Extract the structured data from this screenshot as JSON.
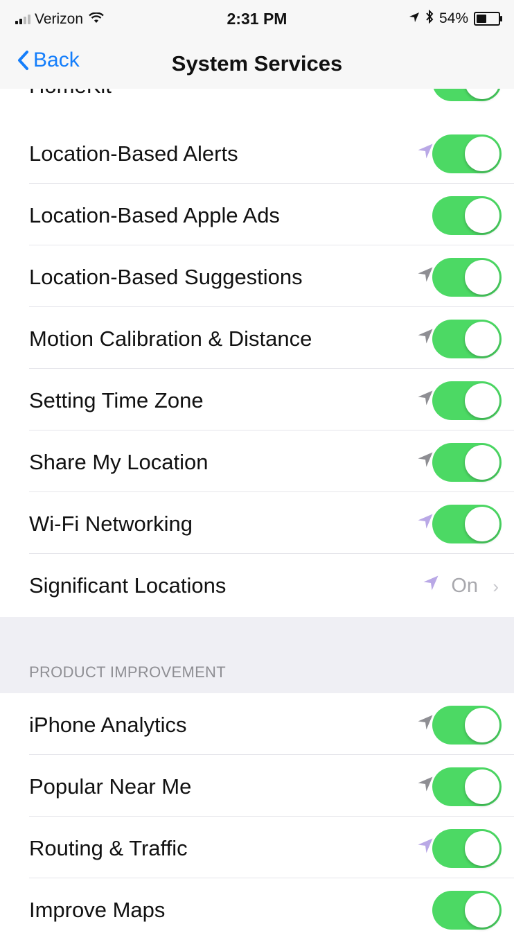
{
  "status_bar": {
    "carrier": "Verizon",
    "time": "2:31 PM",
    "battery_percent": "54%",
    "battery_level": 0.54,
    "icons": [
      "signal-icon",
      "wifi-icon",
      "location-arrow-icon",
      "bluetooth-icon",
      "battery-icon"
    ]
  },
  "nav": {
    "back_label": "Back",
    "title": "System Services"
  },
  "partial_row": {
    "label": "HomeKit",
    "toggle_on": true
  },
  "rows": [
    {
      "label": "Location-Based Alerts",
      "arrow": "purple",
      "toggle_on": true
    },
    {
      "label": "Location-Based Apple Ads",
      "arrow": "none",
      "toggle_on": true
    },
    {
      "label": "Location-Based Suggestions",
      "arrow": "gray",
      "toggle_on": true
    },
    {
      "label": "Motion Calibration & Distance",
      "arrow": "gray",
      "toggle_on": true
    },
    {
      "label": "Setting Time Zone",
      "arrow": "gray",
      "toggle_on": true
    },
    {
      "label": "Share My Location",
      "arrow": "gray",
      "toggle_on": true
    },
    {
      "label": "Wi-Fi Networking",
      "arrow": "purple",
      "toggle_on": true
    },
    {
      "label": "Significant Locations",
      "arrow": "purple",
      "value": "On",
      "disclosure": "chevron-right-icon"
    }
  ],
  "section_header": "PRODUCT IMPROVEMENT",
  "product_rows": [
    {
      "label": "iPhone Analytics",
      "arrow": "gray",
      "toggle_on": true
    },
    {
      "label": "Popular Near Me",
      "arrow": "gray",
      "toggle_on": true
    },
    {
      "label": "Routing & Traffic",
      "arrow": "purple",
      "toggle_on": true
    },
    {
      "label": "Improve Maps",
      "arrow": "none",
      "toggle_on": true
    }
  ],
  "colors": {
    "accent": "#147efb",
    "toggle_on": "#4cd964",
    "arrow_gray": "#8e8e93",
    "arrow_purple": "#b9a8e6",
    "group_background": "#efeff4"
  }
}
